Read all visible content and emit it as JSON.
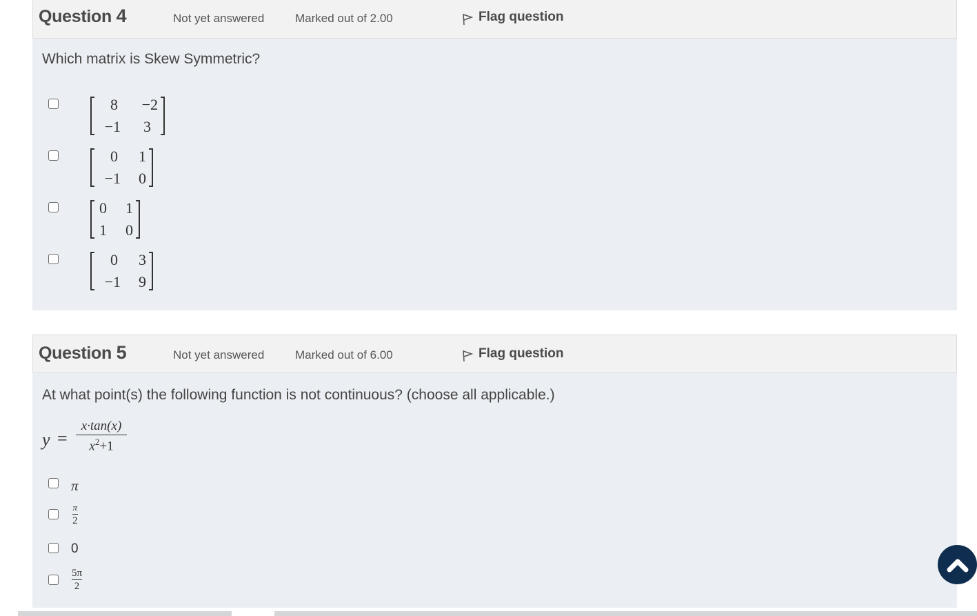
{
  "questions": [
    {
      "title_word": "Question",
      "number": "4",
      "state": "Not yet answered",
      "grade": "Marked out of 2.00",
      "flag_label": "Flag question",
      "text": "Which matrix is Skew Symmetric?",
      "options": [
        {
          "matrix": [
            [
              "8",
              "−2"
            ],
            [
              "−1",
              "3"
            ]
          ],
          "checked": false
        },
        {
          "matrix": [
            [
              "0",
              "1"
            ],
            [
              "−1",
              "0"
            ]
          ],
          "checked": false
        },
        {
          "matrix": [
            [
              "0",
              "1"
            ],
            [
              "1",
              "0"
            ]
          ],
          "checked": false
        },
        {
          "matrix": [
            [
              "0",
              "3"
            ],
            [
              "−1",
              "9"
            ]
          ],
          "checked": false
        }
      ]
    },
    {
      "title_word": "Question",
      "number": "5",
      "state": "Not yet answered",
      "grade": "Marked out of 6.00",
      "flag_label": "Flag question",
      "text": "At what point(s) the following function is not continuous? (choose all applicable.)",
      "formula": {
        "lhs": "y",
        "eq": "=",
        "numerator": "x·tan(x)",
        "denominator_base": "x",
        "denominator_exp": "2",
        "denominator_rest": "+1"
      },
      "options": [
        {
          "label": "π",
          "checked": false
        },
        {
          "num": "π",
          "den": "2",
          "checked": false
        },
        {
          "label": "0",
          "checked": false
        },
        {
          "num": "5π",
          "den": "2",
          "checked": false
        }
      ]
    }
  ],
  "scroll_top_icon": "chevron-up-icon"
}
